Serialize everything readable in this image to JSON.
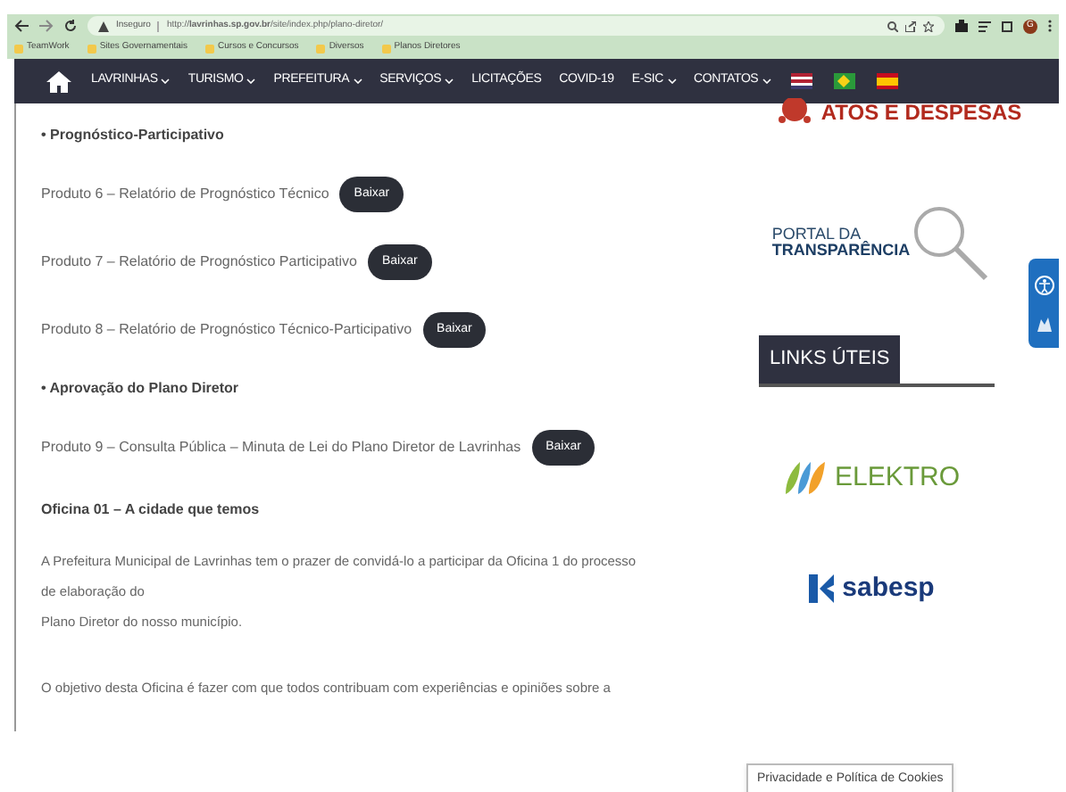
{
  "browser": {
    "security": "Inseguro",
    "url": "http://**lavrinhas.sp.gov.br**/site/index.php/plano-diretor/",
    "profile": "G",
    "bookmarks": [
      "TeamWork",
      "Sites Governamentais",
      "Cursos e Concursos",
      "Diversos",
      "Planos Diretores"
    ]
  },
  "nav": {
    "items": [
      {
        "label": "LAVRINHAS",
        "dropdown": true
      },
      {
        "label": "TURISMO",
        "dropdown": true
      },
      {
        "label": "PREFEITURA",
        "dropdown": true
      },
      {
        "label": "SERVIÇOS",
        "dropdown": true
      },
      {
        "label": "LICITAÇÕES",
        "dropdown": false
      },
      {
        "label": "COVID-19",
        "dropdown": false
      },
      {
        "label": "E-SIC",
        "dropdown": true
      },
      {
        "label": "CONTATOS",
        "dropdown": true
      }
    ],
    "flags": [
      {
        "kind": "us"
      },
      {
        "kind": "br"
      },
      {
        "kind": "es"
      }
    ]
  },
  "content": [
    {
      "kind": "heading",
      "text": "• Prognóstico-Participativo"
    },
    {
      "kind": "product",
      "text": "Produto 6 – Relatório de Prognóstico Técnico",
      "button": "Baixar"
    },
    {
      "kind": "product",
      "text": "Produto 7 – Relatório de Prognóstico Participativo",
      "button": "Baixar"
    },
    {
      "kind": "product",
      "text": "Produto 8 – Relatório de Prognóstico Técnico-Participativo",
      "button": "Baixar"
    },
    {
      "kind": "heading",
      "text": "• Aprovação do Plano Diretor"
    },
    {
      "kind": "product",
      "text": "Produto 9 – Consulta Pública – Minuta de Lei do Plano Diretor de Lavrinhas",
      "button": "Baixar"
    },
    {
      "kind": "title",
      "text": "Oficina 01 – A cidade que temos"
    },
    {
      "kind": "paragraph",
      "lines": [
        "A Prefeitura Municipal de Lavrinhas tem o prazer de convidá-lo a participar da Oficina 1 do processo",
        "de elaboração do",
        "Plano Diretor do nosso município."
      ]
    },
    {
      "kind": "paragraph",
      "lines": [
        "O objetivo desta Oficina é fazer com que todos contribuam com experiências e opiniões sobre a"
      ]
    }
  ],
  "sidebar": {
    "atos": "ATOS E DESPESAS",
    "portal": [
      "PORTAL DA",
      "TRANSPARÊNCIA"
    ],
    "links_heading": "LINKS ÚTEIS",
    "logos": [
      "ELEKTRO",
      "sabesp"
    ]
  },
  "cookie": "Privacidade e Política de Cookies"
}
